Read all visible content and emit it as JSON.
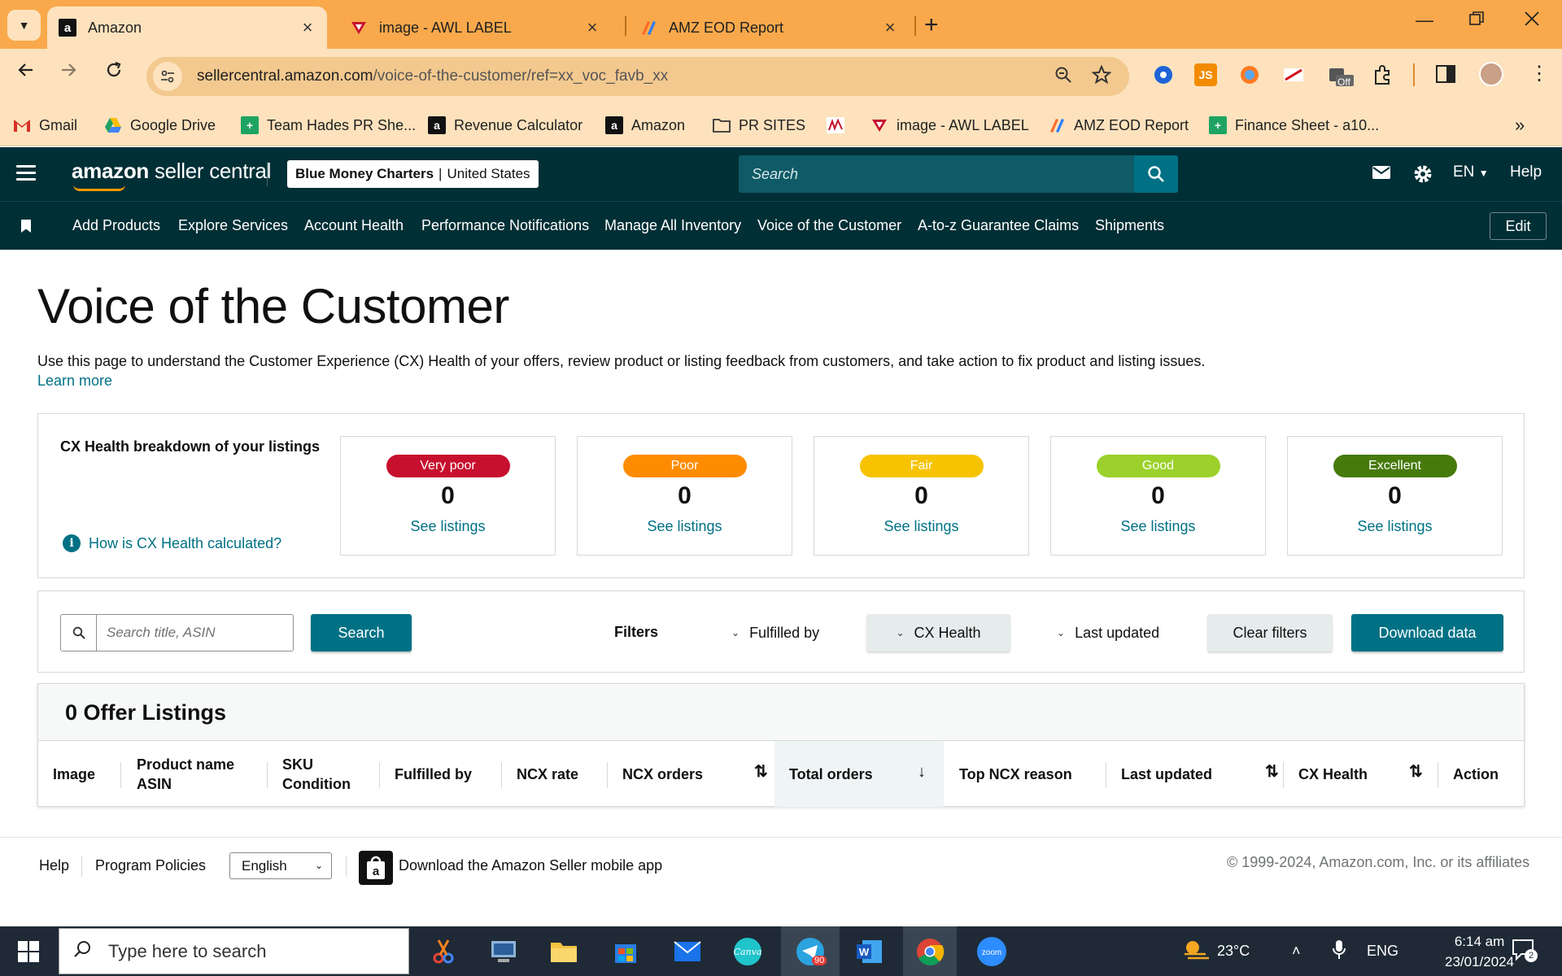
{
  "browser": {
    "tabs": [
      {
        "title": "Amazon",
        "active": true
      },
      {
        "title": "image - AWL LABEL",
        "active": false
      },
      {
        "title": "AMZ EOD Report",
        "active": false
      }
    ],
    "url_host": "sellercentral.amazon.com",
    "url_path": "/voice-of-the-customer/ref=xx_voc_favb_xx",
    "extension_badge": "Off",
    "bookmarks": [
      "Gmail",
      "Google Drive",
      "Team Hades PR She...",
      "Revenue Calculator",
      "Amazon",
      "PR SITES",
      "image - AWL LABEL",
      "AMZ EOD Report",
      "Finance Sheet - a10..."
    ]
  },
  "header": {
    "logo_main": "amazon",
    "logo_rest": " seller central",
    "account_name": "Blue Money Charters",
    "account_region": "United States",
    "search_placeholder": "Search",
    "language": "EN",
    "help": "Help"
  },
  "nav": {
    "links": [
      "Add Products",
      "Explore Services",
      "Account Health",
      "Performance Notifications",
      "Manage All Inventory",
      "Voice of the Customer",
      "A-to-z Guarantee Claims",
      "Shipments"
    ],
    "edit": "Edit"
  },
  "page": {
    "title": "Voice of the Customer",
    "description": "Use this page to understand the Customer Experience (CX) Health of your offers, review product or listing feedback from customers, and take action to fix product and listing issues.",
    "learn_more": "Learn more"
  },
  "cx_health": {
    "label": "CX Health breakdown of your listings",
    "help_link": "How is CX Health calculated?",
    "cards": [
      {
        "status": "Very poor",
        "count": "0",
        "link": "See listings",
        "color": "#c7102e"
      },
      {
        "status": "Poor",
        "count": "0",
        "link": "See listings",
        "color": "#ff8c00"
      },
      {
        "status": "Fair",
        "count": "0",
        "link": "See listings",
        "color": "#f7c300"
      },
      {
        "status": "Good",
        "count": "0",
        "link": "See listings",
        "color": "#9bd12a"
      },
      {
        "status": "Excellent",
        "count": "0",
        "link": "See listings",
        "color": "#467a0b"
      }
    ]
  },
  "filters": {
    "search_placeholder": "Search title, ASIN",
    "search_button": "Search",
    "label": "Filters",
    "fulfilled_by": "Fulfilled by",
    "cx_health": "CX Health",
    "last_updated": "Last updated",
    "clear": "Clear filters",
    "download": "Download data"
  },
  "table": {
    "title": "0 Offer Listings",
    "columns": {
      "image": "Image",
      "product_line1": "Product name",
      "product_line2": "ASIN",
      "sku_line1": "SKU",
      "sku_line2": "Condition",
      "fulfilled_by": "Fulfilled by",
      "ncx_rate": "NCX rate",
      "ncx_orders": "NCX orders",
      "total_orders": "Total orders",
      "top_ncx_reason": "Top NCX reason",
      "last_updated": "Last updated",
      "cx_health": "CX Health",
      "action": "Action"
    }
  },
  "footer": {
    "help": "Help",
    "policies": "Program Policies",
    "language": "English",
    "app_text": "Download the Amazon Seller mobile app",
    "copyright": "© 1999-2024, Amazon.com, Inc. or its affiliates"
  },
  "taskbar": {
    "search_placeholder": "Type here to search",
    "telegram_badge": "90",
    "weather": "23°C",
    "language": "ENG",
    "time": "6:14 am",
    "date": "23/01/2024",
    "notifications": "2"
  },
  "colors": {
    "sc_header": "#002f36",
    "link_teal": "#007185",
    "chrome_orange": "#f9a94c"
  }
}
